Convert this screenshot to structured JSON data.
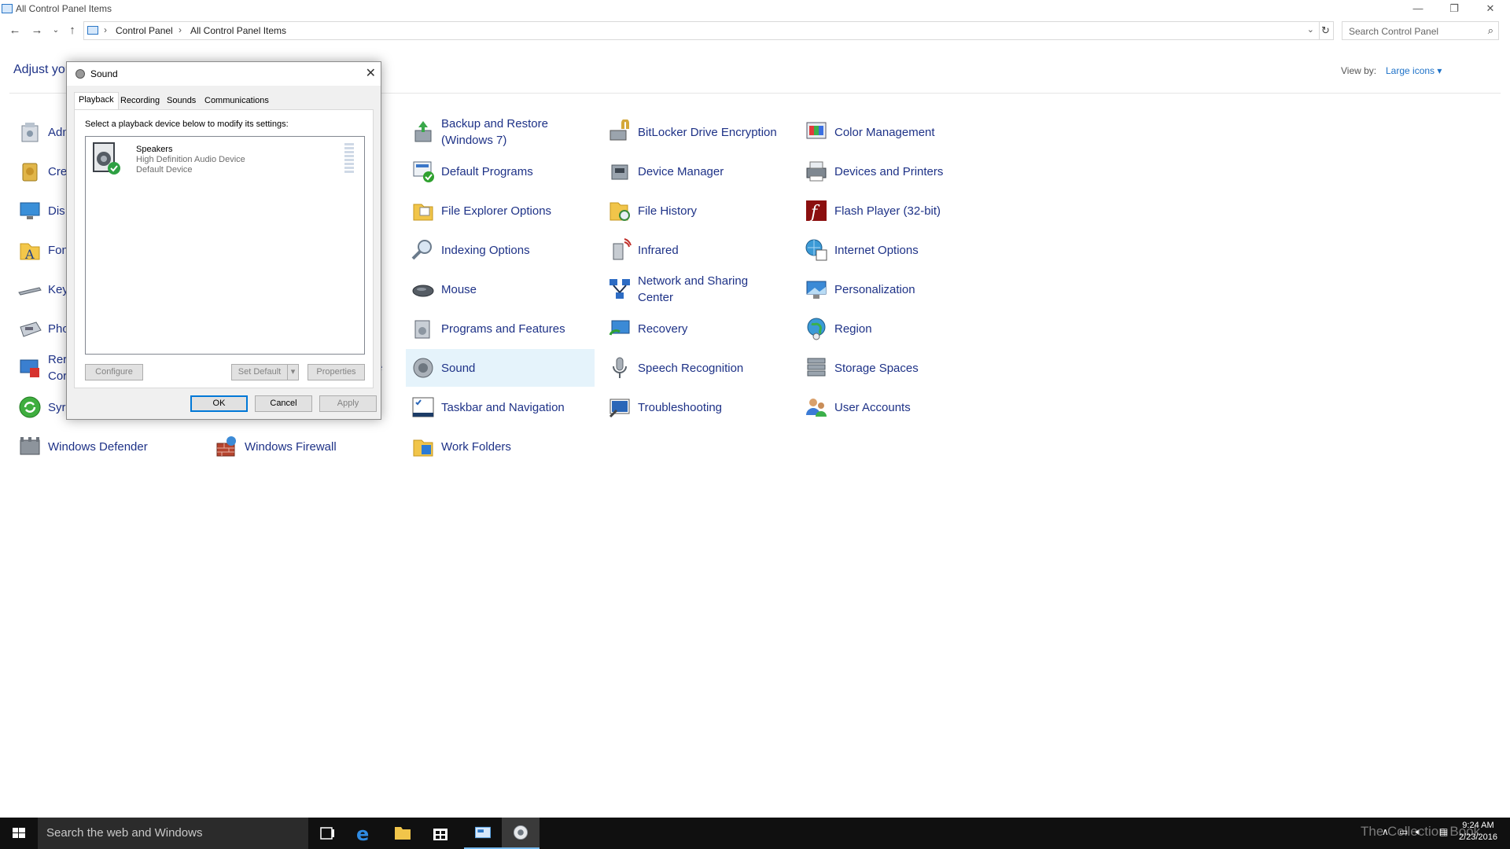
{
  "window": {
    "title": "All Control Panel Items",
    "minimize_glyph": "—",
    "restore_glyph": "❐",
    "close_glyph": "✕"
  },
  "address": {
    "crumbs": [
      "Control Panel",
      "All Control Panel Items"
    ],
    "separator": "›",
    "search_placeholder": "Search Control Panel"
  },
  "header": {
    "heading_partial": "Adjust you",
    "view_by_label": "View by:",
    "view_by_value": "Large icons ▾"
  },
  "items": [
    {
      "label": "Adm",
      "icon": "admin-tools-icon"
    },
    {
      "label": "Cre",
      "icon": "credential-manager-icon"
    },
    {
      "label": "Dis",
      "icon": "display-icon"
    },
    {
      "label": "Fon",
      "icon": "fonts-icon"
    },
    {
      "label": "Key",
      "icon": "keyboard-icon"
    },
    {
      "label": "Pho",
      "icon": "phone-modem-icon"
    },
    {
      "label": "Rer\nCor",
      "icon": "remoteapp-icon"
    },
    {
      "label": "Syr",
      "icon": "sync-center-icon"
    },
    {
      "label": "Windows Defender",
      "icon": "windows-defender-icon"
    },
    {
      "label": "Windows Firewall",
      "icon": "windows-firewall-icon"
    },
    {
      "label": "e",
      "icon": "partial-label"
    },
    {
      "label": "Backup and Restore\n(Windows 7)",
      "icon": "backup-restore-icon"
    },
    {
      "label": "Default Programs",
      "icon": "default-programs-icon"
    },
    {
      "label": "File Explorer Options",
      "icon": "file-explorer-options-icon"
    },
    {
      "label": "Indexing Options",
      "icon": "indexing-options-icon"
    },
    {
      "label": "Mouse",
      "icon": "mouse-icon"
    },
    {
      "label": "Programs and Features",
      "icon": "programs-features-icon"
    },
    {
      "label": "Sound",
      "icon": "sound-icon"
    },
    {
      "label": "Taskbar and Navigation",
      "icon": "taskbar-navigation-icon"
    },
    {
      "label": "Work Folders",
      "icon": "work-folders-icon"
    },
    {
      "label": "BitLocker Drive Encryption",
      "icon": "bitlocker-icon"
    },
    {
      "label": "Device Manager",
      "icon": "device-manager-icon"
    },
    {
      "label": "File History",
      "icon": "file-history-icon"
    },
    {
      "label": "Infrared",
      "icon": "infrared-icon"
    },
    {
      "label": "Network and Sharing\nCenter",
      "icon": "network-sharing-icon"
    },
    {
      "label": "Recovery",
      "icon": "recovery-icon"
    },
    {
      "label": "Speech Recognition",
      "icon": "speech-recognition-icon"
    },
    {
      "label": "Troubleshooting",
      "icon": "troubleshooting-icon"
    },
    {
      "label": "Color Management",
      "icon": "color-management-icon"
    },
    {
      "label": "Devices and Printers",
      "icon": "devices-printers-icon"
    },
    {
      "label": "Flash Player (32-bit)",
      "icon": "flash-player-icon"
    },
    {
      "label": "Internet Options",
      "icon": "internet-options-icon"
    },
    {
      "label": "Personalization",
      "icon": "personalization-icon"
    },
    {
      "label": "Region",
      "icon": "region-icon"
    },
    {
      "label": "Storage Spaces",
      "icon": "storage-spaces-icon"
    },
    {
      "label": "User Accounts",
      "icon": "user-accounts-icon"
    }
  ],
  "dialog": {
    "title": "Sound",
    "close_glyph": "✕",
    "tabs": [
      "Playback",
      "Recording",
      "Sounds",
      "Communications"
    ],
    "active_tab": "Playback",
    "instruction": "Select a playback device below to modify its settings:",
    "device": {
      "name": "Speakers",
      "description": "High Definition Audio Device",
      "status": "Default Device"
    },
    "buttons": {
      "configure": "Configure",
      "set_default": "Set Default",
      "set_default_arrow": "▾",
      "properties": "Properties",
      "ok": "OK",
      "cancel": "Cancel",
      "apply": "Apply"
    }
  },
  "taskbar": {
    "search_placeholder": "Search the web and Windows",
    "watermark": "The Collection Book",
    "time": "9:24 AM",
    "date": "2/23/2016",
    "apps": [
      "task-view-icon",
      "edge-icon",
      "file-explorer-icon",
      "store-icon",
      "control-panel-icon",
      "sound-icon"
    ]
  },
  "colors": {
    "link_blue": "#1e3287",
    "accent": "#0078d7",
    "highlight": "#e5f3fb",
    "taskbar": "#101010"
  }
}
